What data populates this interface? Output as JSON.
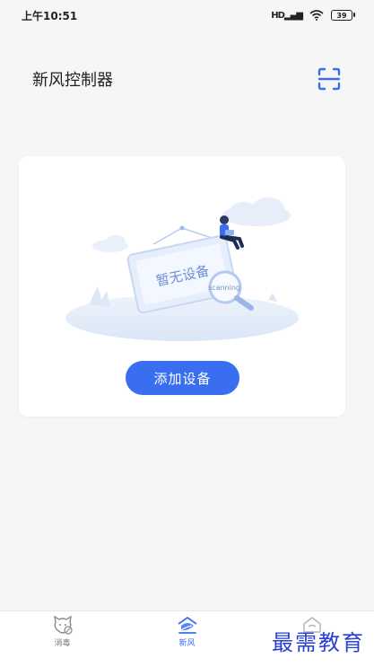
{
  "status_bar": {
    "time": "上午10:51",
    "signal": "HD",
    "battery": "39"
  },
  "header": {
    "title": "新风控制器",
    "scan_icon": "scan-icon"
  },
  "empty_state": {
    "sign_text": "暂无设备",
    "magnifier_text": "scanning",
    "add_button_label": "添加设备"
  },
  "tabs": [
    {
      "label": "消毒",
      "icon": "disinfect-icon",
      "active": false
    },
    {
      "label": "新风",
      "icon": "fresh-air-icon",
      "active": true
    },
    {
      "label": "",
      "icon": "home-icon",
      "active": false
    }
  ],
  "watermark": "最需教育",
  "colors": {
    "accent": "#3a6ef0",
    "background": "#f6f6f6"
  }
}
